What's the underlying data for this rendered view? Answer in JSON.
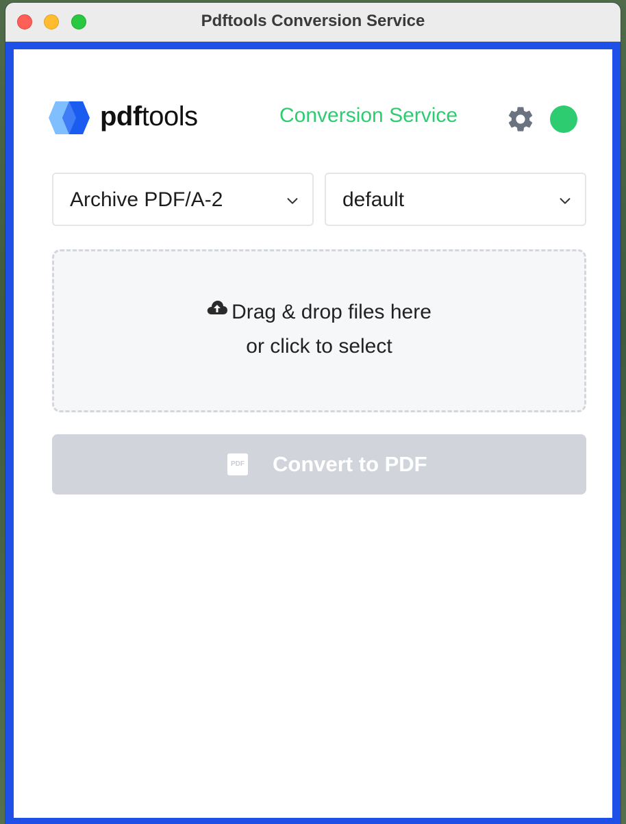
{
  "window": {
    "title": "Pdftools Conversion Service"
  },
  "header": {
    "brand_bold": "pdf",
    "brand_regular": "tools",
    "service_title": "Conversion Service",
    "settings_icon": "gear-icon",
    "status": "online"
  },
  "selects": {
    "profile": {
      "value": "Archive PDF/A-2"
    },
    "config": {
      "value": "default"
    }
  },
  "dropzone": {
    "icon": "cloud-upload-icon",
    "line1": "Drag & drop files here",
    "line2": "or click to select"
  },
  "convert_button": {
    "icon_text": "PDF",
    "label": "Convert to PDF",
    "enabled": false
  },
  "colors": {
    "accent_green": "#2ecc71",
    "window_border_blue": "#1e4fe6",
    "button_disabled": "#d1d5db",
    "logo_light_blue": "#7fbfff",
    "logo_blue": "#1a5cf0"
  }
}
